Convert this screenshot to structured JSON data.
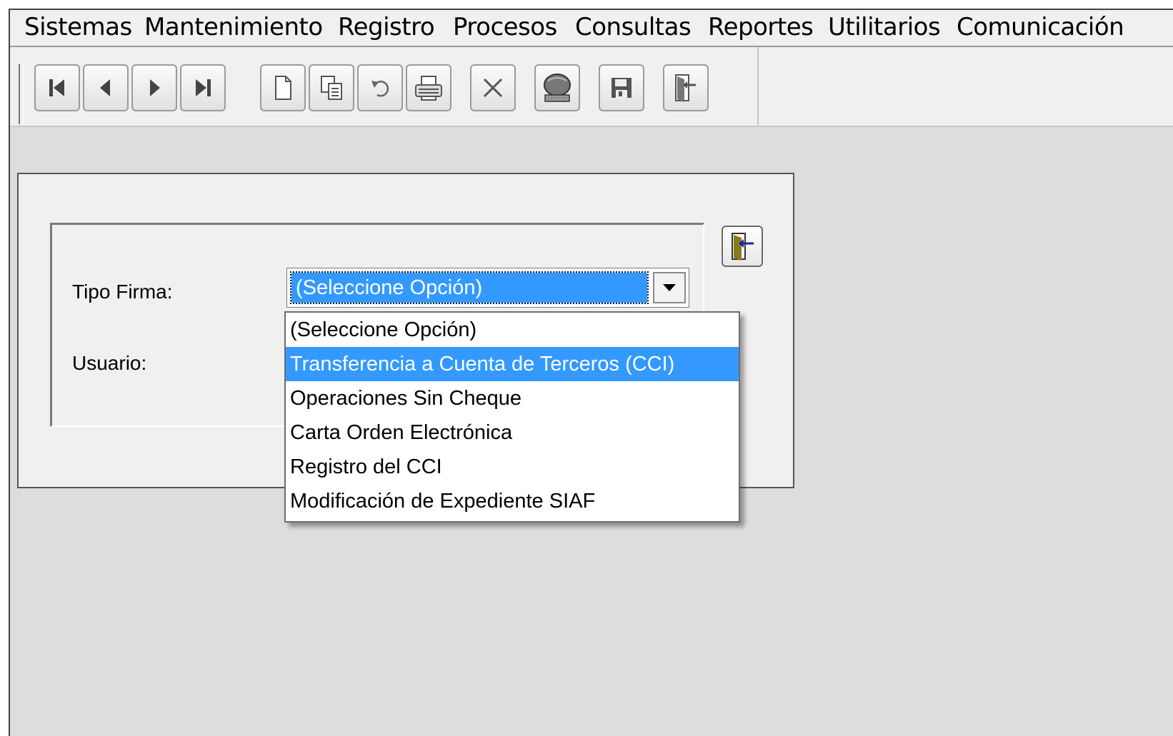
{
  "menu": [
    "Sistemas",
    "Mantenimiento",
    "Registro",
    "Procesos",
    "Consultas",
    "Reportes",
    "Utilitarios",
    "Comunicación"
  ],
  "toolbar": {
    "buttons": [
      "first-record",
      "previous-record",
      "next-record",
      "last-record",
      "new-document",
      "copy",
      "undo",
      "print",
      "delete",
      "search-display",
      "save",
      "exit-door"
    ]
  },
  "form": {
    "tipo_firma_label": "Tipo Firma:",
    "usuario_label": "Usuario:",
    "tipo_firma_value": "(Seleccione Opción)"
  },
  "dropdown": {
    "options": [
      "(Seleccione Opción)",
      "Transferencia a Cuenta de Terceros (CCI)",
      "Operaciones Sin Cheque",
      "Carta Orden Electrónica",
      "Registro del CCI",
      "Modificación de Expediente SIAF"
    ],
    "highlighted_index": 1
  },
  "colors": {
    "selection": "#3399ff",
    "background": "#dddddd",
    "panel": "#f0f0f0"
  }
}
